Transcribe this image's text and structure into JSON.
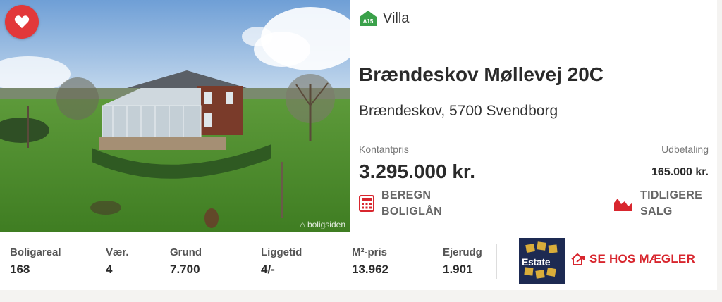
{
  "listing": {
    "favorite_label": "",
    "energy_label": "A15",
    "property_type": "Villa",
    "address_line1": "Brændeskov Møllevej 20C",
    "address_line2": "Brændeskov, 5700 Svendborg",
    "cash_price_label": "Kontantpris",
    "cash_price": "3.295.000 kr.",
    "down_payment_label": "Udbetaling",
    "down_payment": "165.000 kr.",
    "calc_loan_line1": "BEREGN",
    "calc_loan_line2": "BOLIGLÅN",
    "history_line1": "TIDLIGERE",
    "history_line2": "SALG",
    "photo_watermark": "boligsiden"
  },
  "facts": [
    {
      "label": "Boligareal",
      "value": "168"
    },
    {
      "label": "Vær.",
      "value": "4"
    },
    {
      "label": "Grund",
      "value": "7.700"
    },
    {
      "label": "Liggetid",
      "value": "4/-"
    },
    {
      "label": "M²-pris",
      "value": "13.962"
    },
    {
      "label": "Ejerudg",
      "value": "1.901"
    }
  ],
  "broker": {
    "logo_text": "Estate",
    "cta": "SE HOS MÆGLER"
  },
  "colors": {
    "accent_red": "#d8262e",
    "energy_green": "#3aa14a",
    "broker_navy": "#1d2a52"
  },
  "icons": {
    "favorite": "heart-icon",
    "energy": "house-energy-icon",
    "calculator": "calculator-icon",
    "history": "area-chart-icon",
    "broker_link": "external-link-icon"
  }
}
